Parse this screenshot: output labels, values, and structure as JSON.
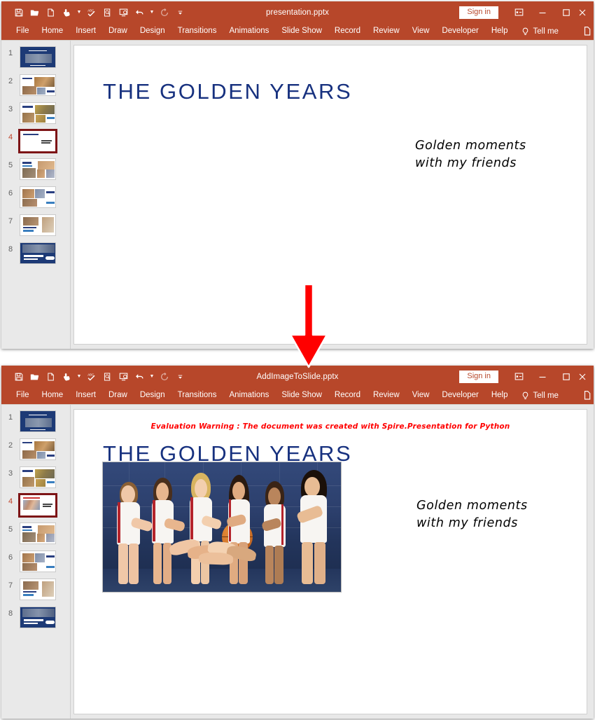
{
  "windows": [
    {
      "id": "before",
      "title": "presentation.pptx",
      "sign_in_label": "Sign in",
      "quick_access": [
        {
          "name": "save-icon",
          "label": "Save"
        },
        {
          "name": "open-folder-icon",
          "label": "Open"
        },
        {
          "name": "new-document-icon",
          "label": "New"
        },
        {
          "name": "touch-mode-icon",
          "label": "Touch/Mouse Mode"
        },
        {
          "name": "spelling-abc-icon",
          "label": "Spelling"
        },
        {
          "name": "print-preview-icon",
          "label": "Print Preview and Print"
        },
        {
          "name": "start-slideshow-icon",
          "label": "Start From Beginning"
        },
        {
          "name": "undo-icon",
          "label": "Undo"
        },
        {
          "name": "redo-icon",
          "label": "Redo"
        },
        {
          "name": "customize-qat-icon",
          "label": "Customize Quick Access Toolbar"
        }
      ],
      "window_controls": [
        {
          "name": "ribbon-display-options-icon",
          "label": "Ribbon Display Options"
        },
        {
          "name": "minimize-icon",
          "label": "Minimize"
        },
        {
          "name": "maximize-icon",
          "label": "Maximize"
        },
        {
          "name": "close-icon",
          "label": "Close"
        }
      ],
      "menu": [
        "File",
        "Home",
        "Insert",
        "Draw",
        "Design",
        "Transitions",
        "Animations",
        "Slide Show",
        "Record",
        "Review",
        "View",
        "Developer",
        "Help"
      ],
      "tell_me": "Tell me",
      "slides": [
        {
          "number": "1",
          "active": false,
          "kind": "navy-photo"
        },
        {
          "number": "2",
          "active": false,
          "kind": "white-photos"
        },
        {
          "number": "3",
          "active": false,
          "kind": "white-photos"
        },
        {
          "number": "4",
          "active": true,
          "kind": "title-only"
        },
        {
          "number": "5",
          "active": false,
          "kind": "white-photos"
        },
        {
          "number": "6",
          "active": false,
          "kind": "white-photos"
        },
        {
          "number": "7",
          "active": false,
          "kind": "white-photos"
        },
        {
          "number": "8",
          "active": false,
          "kind": "navy-photo"
        }
      ],
      "slide": {
        "title": "THE GOLDEN YEARS",
        "subtitle": "Golden moments\nwith my friends",
        "has_image": false,
        "evaluation_warning": null
      }
    },
    {
      "id": "after",
      "title": "AddImageToSlide.pptx",
      "sign_in_label": "Sign in",
      "quick_access": [
        {
          "name": "save-icon",
          "label": "Save"
        },
        {
          "name": "open-folder-icon",
          "label": "Open"
        },
        {
          "name": "new-document-icon",
          "label": "New"
        },
        {
          "name": "touch-mode-icon",
          "label": "Touch/Mouse Mode"
        },
        {
          "name": "spelling-abc-icon",
          "label": "Spelling"
        },
        {
          "name": "print-preview-icon",
          "label": "Print Preview and Print"
        },
        {
          "name": "start-slideshow-icon",
          "label": "Start From Beginning"
        },
        {
          "name": "undo-icon",
          "label": "Undo"
        },
        {
          "name": "redo-icon",
          "label": "Redo"
        },
        {
          "name": "customize-qat-icon",
          "label": "Customize Quick Access Toolbar"
        }
      ],
      "window_controls": [
        {
          "name": "ribbon-display-options-icon",
          "label": "Ribbon Display Options"
        },
        {
          "name": "minimize-icon",
          "label": "Minimize"
        },
        {
          "name": "maximize-icon",
          "label": "Maximize"
        },
        {
          "name": "close-icon",
          "label": "Close"
        }
      ],
      "menu": [
        "File",
        "Home",
        "Insert",
        "Draw",
        "Design",
        "Transitions",
        "Animations",
        "Slide Show",
        "Record",
        "Review",
        "View",
        "Developer",
        "Help"
      ],
      "tell_me": "Tell me",
      "slides": [
        {
          "number": "1",
          "active": false,
          "kind": "navy-photo"
        },
        {
          "number": "2",
          "active": false,
          "kind": "white-photos"
        },
        {
          "number": "3",
          "active": false,
          "kind": "white-photos"
        },
        {
          "number": "4",
          "active": true,
          "kind": "title-with-image"
        },
        {
          "number": "5",
          "active": false,
          "kind": "white-photos"
        },
        {
          "number": "6",
          "active": false,
          "kind": "white-photos"
        },
        {
          "number": "7",
          "active": false,
          "kind": "white-photos"
        },
        {
          "number": "8",
          "active": false,
          "kind": "navy-photo"
        }
      ],
      "slide": {
        "title": "THE GOLDEN YEARS",
        "subtitle": "Golden moments\nwith my friends",
        "has_image": true,
        "image_alt": "Girls basketball team huddle with hands together holding a basketball",
        "evaluation_warning": "Evaluation Warning : The document was created with Spire.Presentation for Python"
      }
    }
  ],
  "annotation": {
    "arrow_name": "red-down-arrow",
    "arrow_color": "#ff0000"
  },
  "theme": {
    "ribbon": "#b7472a",
    "title_text": "#17317f",
    "warning_text": "#ff0000",
    "active_thumb_border": "#7d1416",
    "active_thumb_number": "#c0432a"
  }
}
